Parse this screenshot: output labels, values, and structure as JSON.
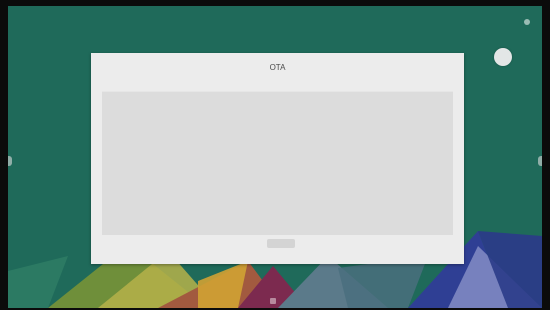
{
  "status_bar": {
    "info": "",
    "icon": "status-icon"
  },
  "dialog": {
    "title": "OTA",
    "log_lines": [
      "",
      "",
      ""
    ],
    "button_label": ""
  },
  "navbar": {
    "label": "",
    "icon": "home-icon"
  },
  "colors": {
    "wallpaper": "#1f6a5a",
    "dialog_bg": "#ececec",
    "log_bg": "#dcdcdc"
  }
}
